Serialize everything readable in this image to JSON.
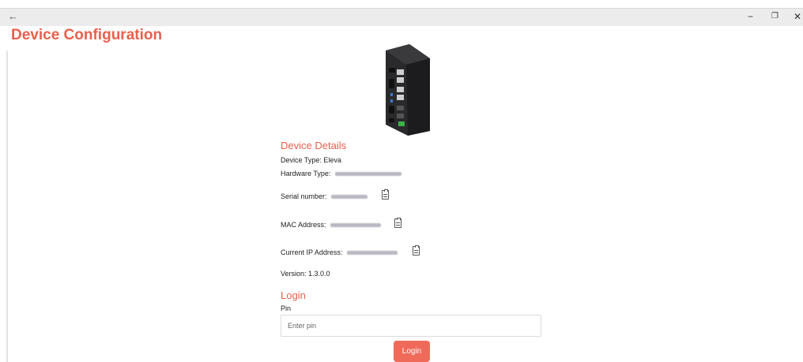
{
  "window": {
    "back_glyph": "←",
    "minimize_glyph": "−",
    "restore_glyph": "❐",
    "close_glyph": "✕"
  },
  "page": {
    "title": "Device Configuration"
  },
  "device_details": {
    "heading": "Device Details",
    "device_type_label": "Device Type: Eleva",
    "hardware_type_label": "Hardware Type:",
    "serial_label": "Serial number:",
    "mac_label": "MAC Address:",
    "ip_label": "Current IP Address:",
    "version_label": "Version: 1.3.0.0"
  },
  "login": {
    "heading": "Login",
    "pin_label": "Pin",
    "pin_placeholder": "Enter pin",
    "pin_value": "",
    "button_label": "Login"
  },
  "colors": {
    "accent": "#e8604c",
    "button": "#f06a5a"
  },
  "icons": {
    "copy": "clipboard-icon",
    "device": "industrial-pc-image"
  }
}
